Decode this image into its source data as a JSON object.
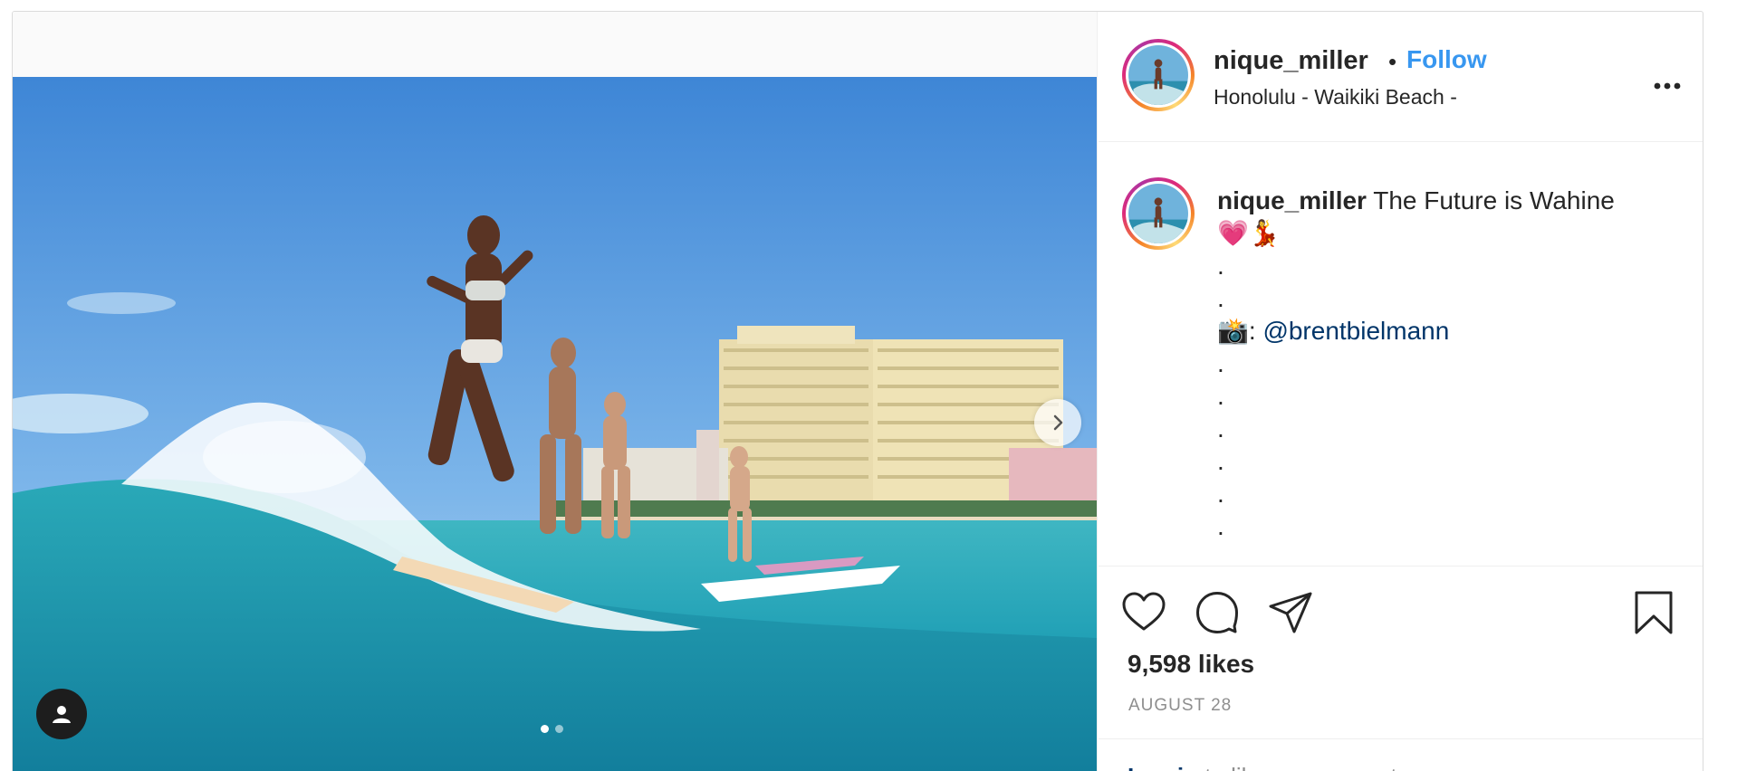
{
  "post": {
    "username": "nique_miller",
    "separator": "•",
    "follow_label": "Follow",
    "location": "Honolulu - Waikiki Beach -",
    "more_icon": "more-options-icon",
    "caption": {
      "username": "nique_miller",
      "text": "The Future is Wahine",
      "emoji_line": "💗💃",
      "dot": ".",
      "credit_emoji": "📸",
      "credit_sep": ": ",
      "credit_mention": "@brentbielmann"
    },
    "likes": "9,598 likes",
    "date": "AUGUST 28",
    "comment_prompt": {
      "login_label": "Log in",
      "rest": " to like or comment."
    },
    "carousel": {
      "current": 1,
      "total": 2
    }
  },
  "colors": {
    "follow_blue": "#3897f0",
    "mention_blue": "#003569",
    "border": "#dbdbdb",
    "muted": "#8e8e8e"
  }
}
